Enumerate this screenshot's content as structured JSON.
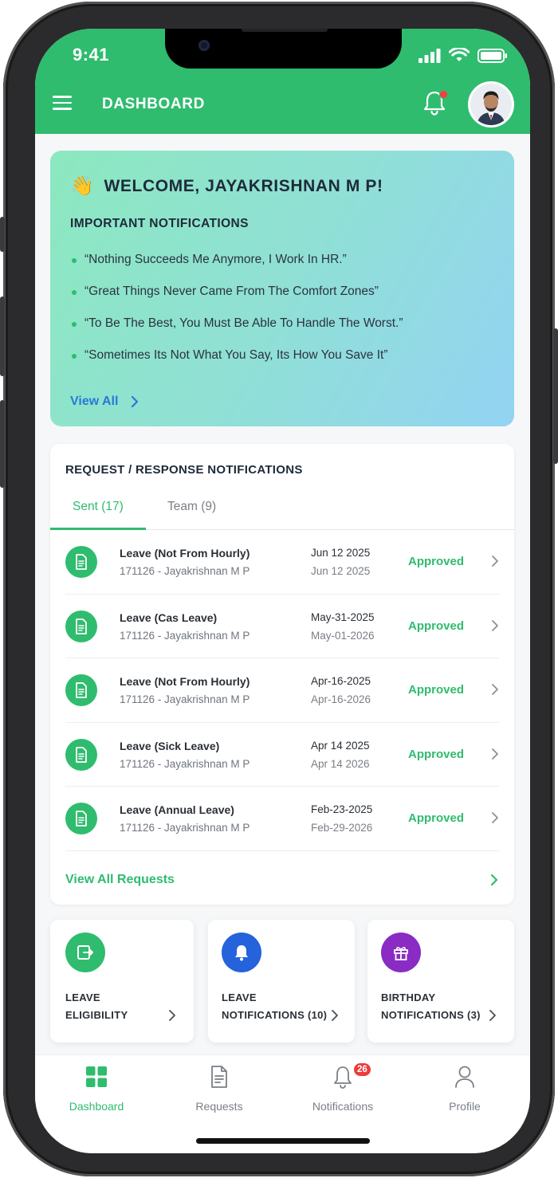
{
  "status": {
    "time": "9:41"
  },
  "header": {
    "title": "DASHBOARD"
  },
  "welcome": {
    "emoji": "👋",
    "greeting": "WELCOME, JAYAKRISHNAN M P!",
    "section_title": "IMPORTANT NOTIFICATIONS",
    "quotes": [
      "“Nothing Succeeds Me Anymore, I Work In HR.”",
      "“Great Things Never Came From The Comfort Zones”",
      "“To Be The Best, You Must Be Able To Handle The Worst.”",
      "“Sometimes Its Not What You Say, Its How You Save It”"
    ],
    "view_all": "View All"
  },
  "requests": {
    "title": "REQUEST / RESPONSE NOTIFICATIONS",
    "tabs": [
      {
        "label": "Sent (17)"
      },
      {
        "label": "Team (9)"
      }
    ],
    "rows": [
      {
        "name": "Leave (Not From Hourly)",
        "employee": "171126 - Jayakrishnan M P",
        "date1": "Jun 12 2025",
        "date2": "Jun 12 2025",
        "status": "Approved"
      },
      {
        "name": "Leave (Cas Leave)",
        "employee": "171126 - Jayakrishnan M P",
        "date1": "May-31-2025",
        "date2": "May-01-2026",
        "status": "Approved"
      },
      {
        "name": "Leave (Not From Hourly)",
        "employee": "171126 - Jayakrishnan M P",
        "date1": "Apr-16-2025",
        "date2": "Apr-16-2026",
        "status": "Approved"
      },
      {
        "name": "Leave (Sick Leave)",
        "employee": "171126 - Jayakrishnan M P",
        "date1": "Apr 14 2025",
        "date2": "Apr 14 2026",
        "status": "Approved"
      },
      {
        "name": "Leave (Annual Leave)",
        "employee": "171126 - Jayakrishnan M P",
        "date1": "Feb-23-2025",
        "date2": "Feb-29-2026",
        "status": "Approved"
      }
    ],
    "view_all": "View All Requests"
  },
  "quick_cards": [
    {
      "line1": "LEAVE",
      "line2": "ELIGIBILITY",
      "icon": "exit-icon",
      "color": "#2fbc6e"
    },
    {
      "line1": "LEAVE",
      "line2": "NOTIFICATIONS (10)",
      "icon": "bell-icon",
      "color": "#2463db"
    },
    {
      "line1": "BIRTHDAY",
      "line2": "NOTIFICATIONS (3)",
      "icon": "gift-icon",
      "color": "#8a2bc4"
    }
  ],
  "bottom_nav": {
    "items": [
      {
        "label": "Dashboard",
        "icon": "grid-icon",
        "active": true
      },
      {
        "label": "Requests",
        "icon": "document-icon"
      },
      {
        "label": "Notifications",
        "icon": "bell-icon",
        "badge": "26"
      },
      {
        "label": "Profile",
        "icon": "person-icon"
      }
    ]
  },
  "colors": {
    "brand": "#2fbc6e",
    "link": "#2879d8",
    "badge": "#ee3b3b"
  }
}
